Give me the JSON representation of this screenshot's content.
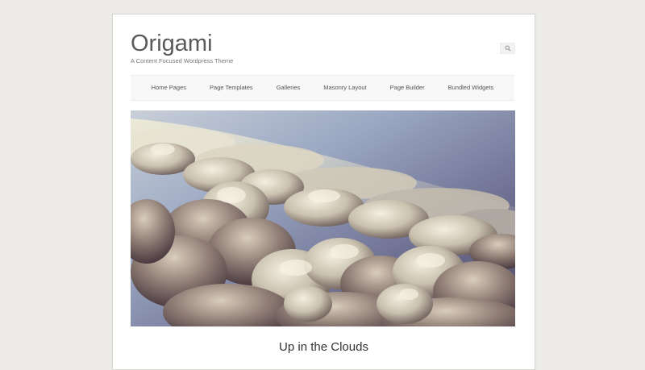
{
  "site": {
    "title": "Origami",
    "description": "A Content Focused Wordpress Theme"
  },
  "search": {
    "icon": "search-icon"
  },
  "nav": {
    "items": [
      {
        "label": "Home Pages"
      },
      {
        "label": "Page Templates"
      },
      {
        "label": "Galleries"
      },
      {
        "label": "Masonry Layout"
      },
      {
        "label": "Page Builder"
      },
      {
        "label": "Bundled Widgets"
      }
    ]
  },
  "post": {
    "title": "Up in the Clouds",
    "image": "clouds-photo"
  },
  "colors": {
    "background": "#edece8",
    "page": "#ffffff",
    "title_text": "#5a5a5a",
    "nav_bg": "#f8f8f8"
  }
}
